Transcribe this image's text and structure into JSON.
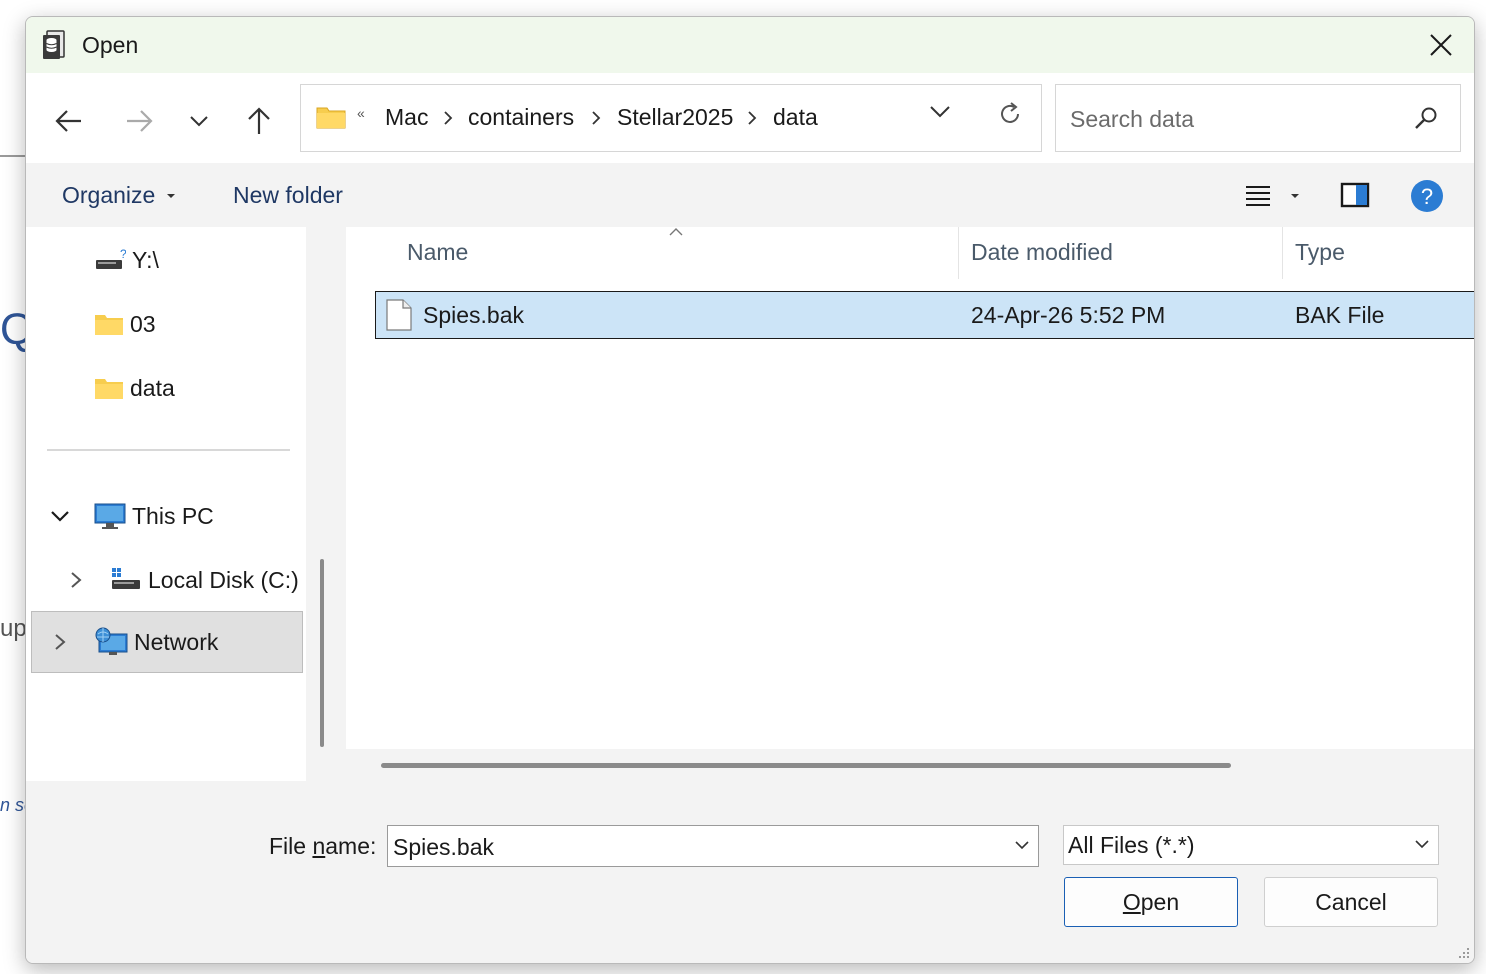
{
  "background": {
    "fragment_q": "Q",
    "fragment_up": "up",
    "fragment_se": "n se"
  },
  "window": {
    "title": "Open",
    "app_icon": "database-icon",
    "close_icon": "close-icon"
  },
  "nav": {
    "back_icon": "arrow-left-icon",
    "forward_icon": "arrow-right-icon",
    "recent_icon": "chevron-down-icon",
    "up_icon": "arrow-up-icon",
    "breadcrumb_overflow": "«",
    "breadcrumbs": [
      "Mac",
      "containers",
      "Stellar2025",
      "data"
    ],
    "refresh_icon": "refresh-icon"
  },
  "search": {
    "placeholder": "Search data",
    "value": ""
  },
  "toolbar": {
    "organize_label": "Organize",
    "new_folder_label": "New folder",
    "view_icon": "view-list-icon",
    "preview_icon": "preview-pane-icon",
    "help_icon": "help-icon"
  },
  "tree": {
    "items": [
      {
        "label": "Y:\\",
        "icon": "network-drive-icon"
      },
      {
        "label": "03",
        "icon": "folder-icon"
      },
      {
        "label": "data",
        "icon": "folder-icon"
      },
      {
        "label": "This PC",
        "icon": "computer-icon",
        "expanded": true
      },
      {
        "label": "Local Disk (C:)",
        "icon": "disk-icon",
        "expanded": false
      },
      {
        "label": "Network",
        "icon": "network-icon",
        "expanded": false,
        "selected": true
      }
    ]
  },
  "file_list": {
    "columns": [
      "Name",
      "Date modified",
      "Type"
    ],
    "sorted_by": "Name",
    "rows": [
      {
        "name": "Spies.bak",
        "date_modified": "24-Apr-26 5:52 PM",
        "type": "BAK File",
        "selected": true
      }
    ]
  },
  "footer": {
    "file_name_label_pre": "File ",
    "file_name_label_accel": "n",
    "file_name_label_post": "ame:",
    "file_name_value": "Spies.bak",
    "filter_value": "All Files (*.*)",
    "open_accel": "O",
    "open_rest": "pen",
    "cancel_label": "Cancel"
  },
  "colors": {
    "title_bar": "#f0f8ec",
    "selection": "#cce4f7",
    "help_blue": "#2b7cd3",
    "folder_yellow": "#f7cd4e"
  }
}
